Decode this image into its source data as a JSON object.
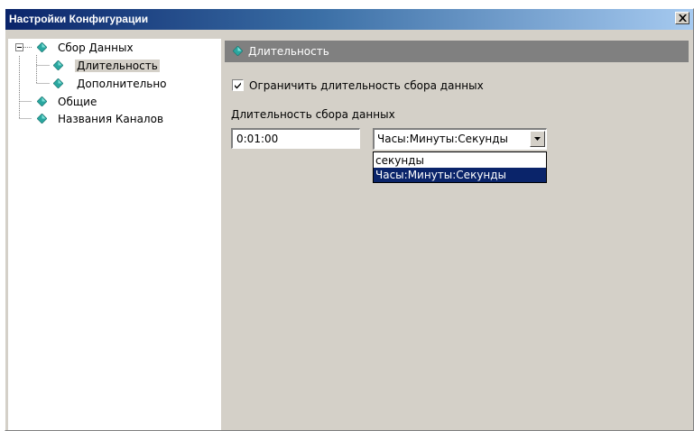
{
  "window": {
    "title": "Настройки Конфигурации"
  },
  "tree": {
    "items": [
      {
        "label": "Сбор Данных",
        "icon": "diamond-icon",
        "expanded": true
      },
      {
        "label": "Длительность",
        "icon": "diamond-icon",
        "selected": true
      },
      {
        "label": "Дополнительно",
        "icon": "diamond-icon"
      },
      {
        "label": "Общие",
        "icon": "diamond-icon"
      },
      {
        "label": "Названия Каналов",
        "icon": "diamond-icon"
      }
    ]
  },
  "panel": {
    "title": "Длительность",
    "limit_checkbox": {
      "label": "Ограничить длительность сбора данных",
      "checked": true
    },
    "duration_label": "Длительность сбора данных",
    "duration_value": "0:01:00",
    "format_combo": {
      "value": "Часы:Минуты:Секунды",
      "options": [
        "секунды",
        "Часы:Минуты:Секунды"
      ],
      "selected_index": 1
    }
  },
  "colors": {
    "title_bar_start": "#0a246a",
    "title_bar_end": "#a6caf0",
    "window_face": "#d4d0c8",
    "header_bar": "#808080",
    "tree_icon": "#2aa7a0",
    "selection": "#0a246a"
  }
}
